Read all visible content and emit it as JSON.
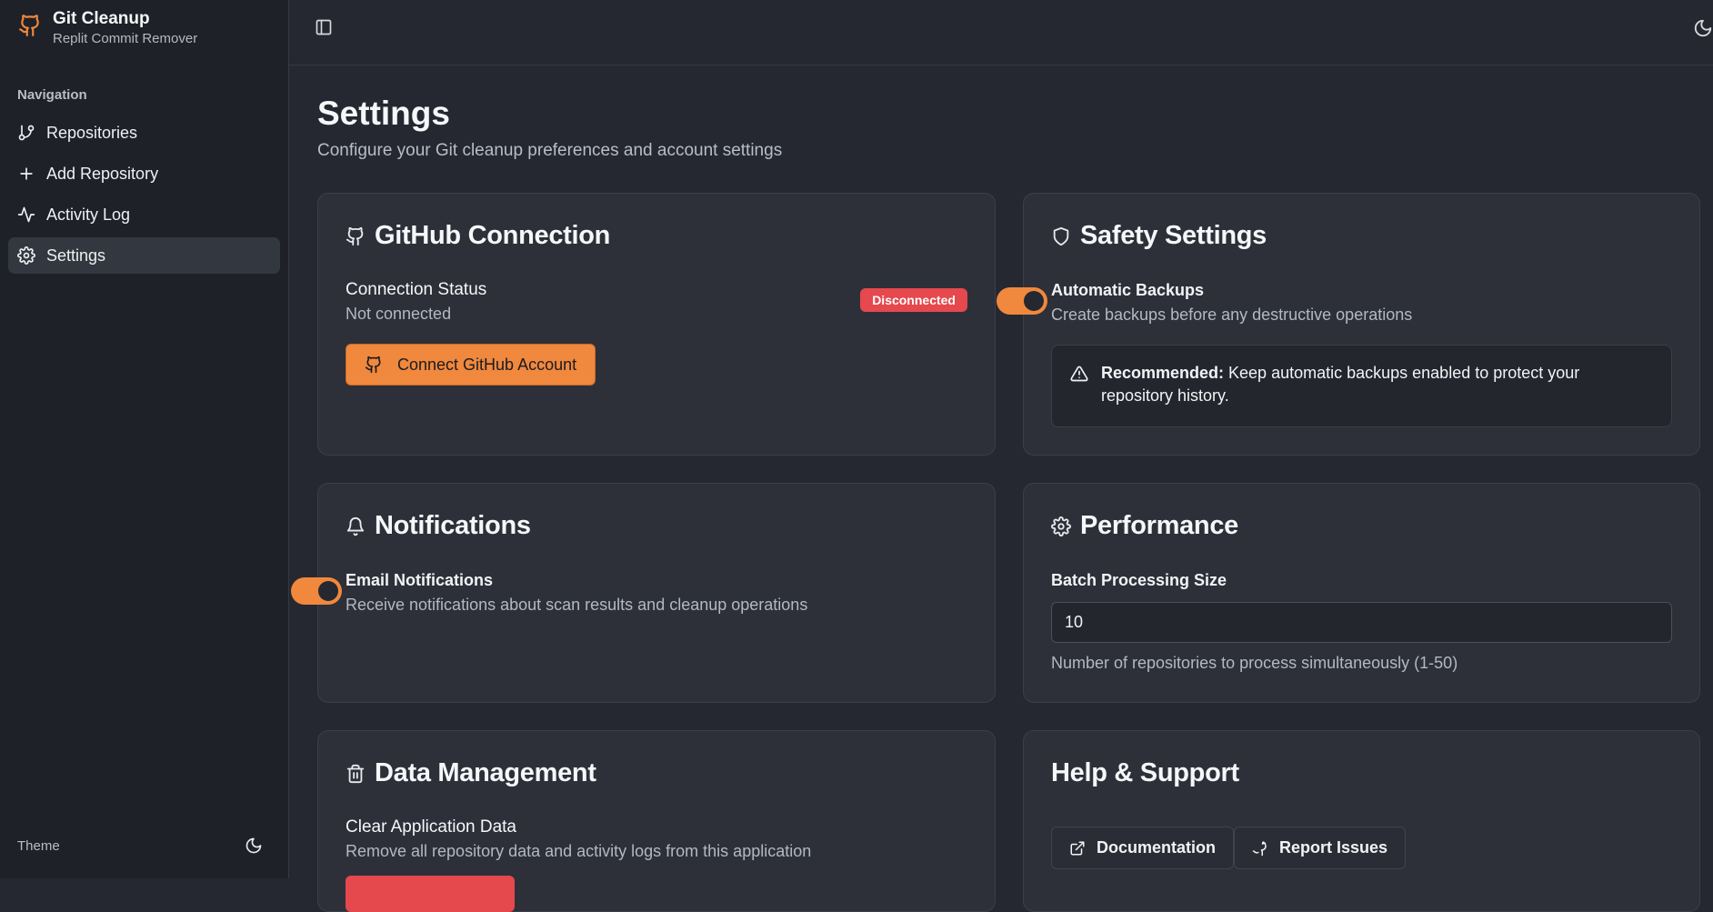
{
  "app": {
    "name": "Git Cleanup",
    "subtitle": "Replit Commit Remover"
  },
  "sidebar": {
    "section_title": "Navigation",
    "items": [
      {
        "label": "Repositories",
        "icon": "git-branch-icon",
        "active": false
      },
      {
        "label": "Add Repository",
        "icon": "plus-icon",
        "active": false
      },
      {
        "label": "Activity Log",
        "icon": "activity-icon",
        "active": false
      },
      {
        "label": "Settings",
        "icon": "gear-icon",
        "active": true
      }
    ],
    "theme_label": "Theme"
  },
  "page": {
    "title": "Settings",
    "subtitle": "Configure your Git cleanup preferences and account settings"
  },
  "github": {
    "title": "GitHub Connection",
    "status_label": "Connection Status",
    "status_value": "Not connected",
    "badge": "Disconnected",
    "connect_button": "Connect GitHub Account"
  },
  "safety": {
    "title": "Safety Settings",
    "backups_label": "Automatic Backups",
    "backups_desc": "Create backups before any destructive operations",
    "backups_enabled": true,
    "alert_strong": "Recommended:",
    "alert_text": " Keep automatic backups enabled to protect your repository history."
  },
  "notifications": {
    "title": "Notifications",
    "email_label": "Email Notifications",
    "email_desc": "Receive notifications about scan results and cleanup operations",
    "email_enabled": true
  },
  "performance": {
    "title": "Performance",
    "batch_label": "Batch Processing Size",
    "batch_value": "10",
    "batch_help": "Number of repositories to process simultaneously (1-50)"
  },
  "data_management": {
    "title": "Data Management",
    "clear_label": "Clear Application Data",
    "clear_desc": "Remove all repository data and activity logs from this application"
  },
  "help": {
    "title": "Help & Support",
    "docs_button": "Documentation",
    "issues_button": "Report Issues"
  },
  "colors": {
    "accent": "#f0883e",
    "danger": "#e5484d",
    "background": "#252830",
    "card": "#2d3039",
    "sidebar": "#1f2128"
  }
}
